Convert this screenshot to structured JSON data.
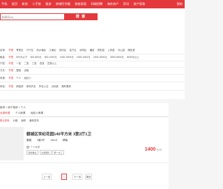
{
  "nav": {
    "items": [
      "手机",
      "首页",
      "新房",
      "二手房",
      "租房",
      "商铺写字楼",
      "装修家居",
      "同城招聘",
      "海外房产",
      "资讯",
      "房产家装"
    ],
    "right": "我的"
  },
  "search": {
    "placeholder": "关键词(A)",
    "button": "搜 索"
  },
  "filters": {
    "district": {
      "label": "区域:",
      "items": [
        "不限",
        "青秀区",
        "兴宁区",
        "西乡塘区",
        "江南区",
        "良庆区",
        "邕宁区",
        "武鸣区",
        "横县",
        "宾阳县",
        "上林县",
        "马山县",
        "隆安县"
      ]
    },
    "rent": {
      "label": "租金:",
      "items": [
        "不限",
        "500元以下",
        "500-800元",
        "800-1000元",
        "1000-1500元",
        "1500-2000元",
        "2000-3000元",
        "3000-5000元",
        "5000元以上"
      ]
    },
    "type": {
      "label": "户型:",
      "items": [
        "不限",
        "一室",
        "二室",
        "三室",
        "四室",
        "四室以上"
      ]
    },
    "mode": {
      "label": "方式:",
      "items": [
        "不限",
        "整租",
        "合租"
      ]
    },
    "source": {
      "label": "来源:",
      "items": [
        "不限",
        "个人",
        "经纪人"
      ]
    },
    "feature": {
      "label": "特色:",
      "items": [
        "不限",
        "精装修",
        "家电齐全",
        "拎包入住",
        "近地铁",
        "随时看房"
      ]
    }
  },
  "breadcrumb": "租房 > 南宁租房 > 个人",
  "tabs": [
    "全部房源",
    "个人房源",
    "经纪人房源"
  ],
  "sorts": [
    "默认排序",
    "价格",
    "面积",
    "最新发布"
  ],
  "listing": {
    "title": "鹤城区世纪花园140平方米 3室2厅1卫",
    "meta": [
      "整租",
      "3室2厅",
      "140㎡",
      "精装"
    ],
    "agent": "个人房源",
    "tags": [
      "随时看房",
      "交通便利",
      "押一付三"
    ],
    "price": "1400",
    "unit": "元/月"
  },
  "pager": {
    "prev": "上一页",
    "current": "1",
    "next": "下一页",
    "last": "尾页"
  }
}
